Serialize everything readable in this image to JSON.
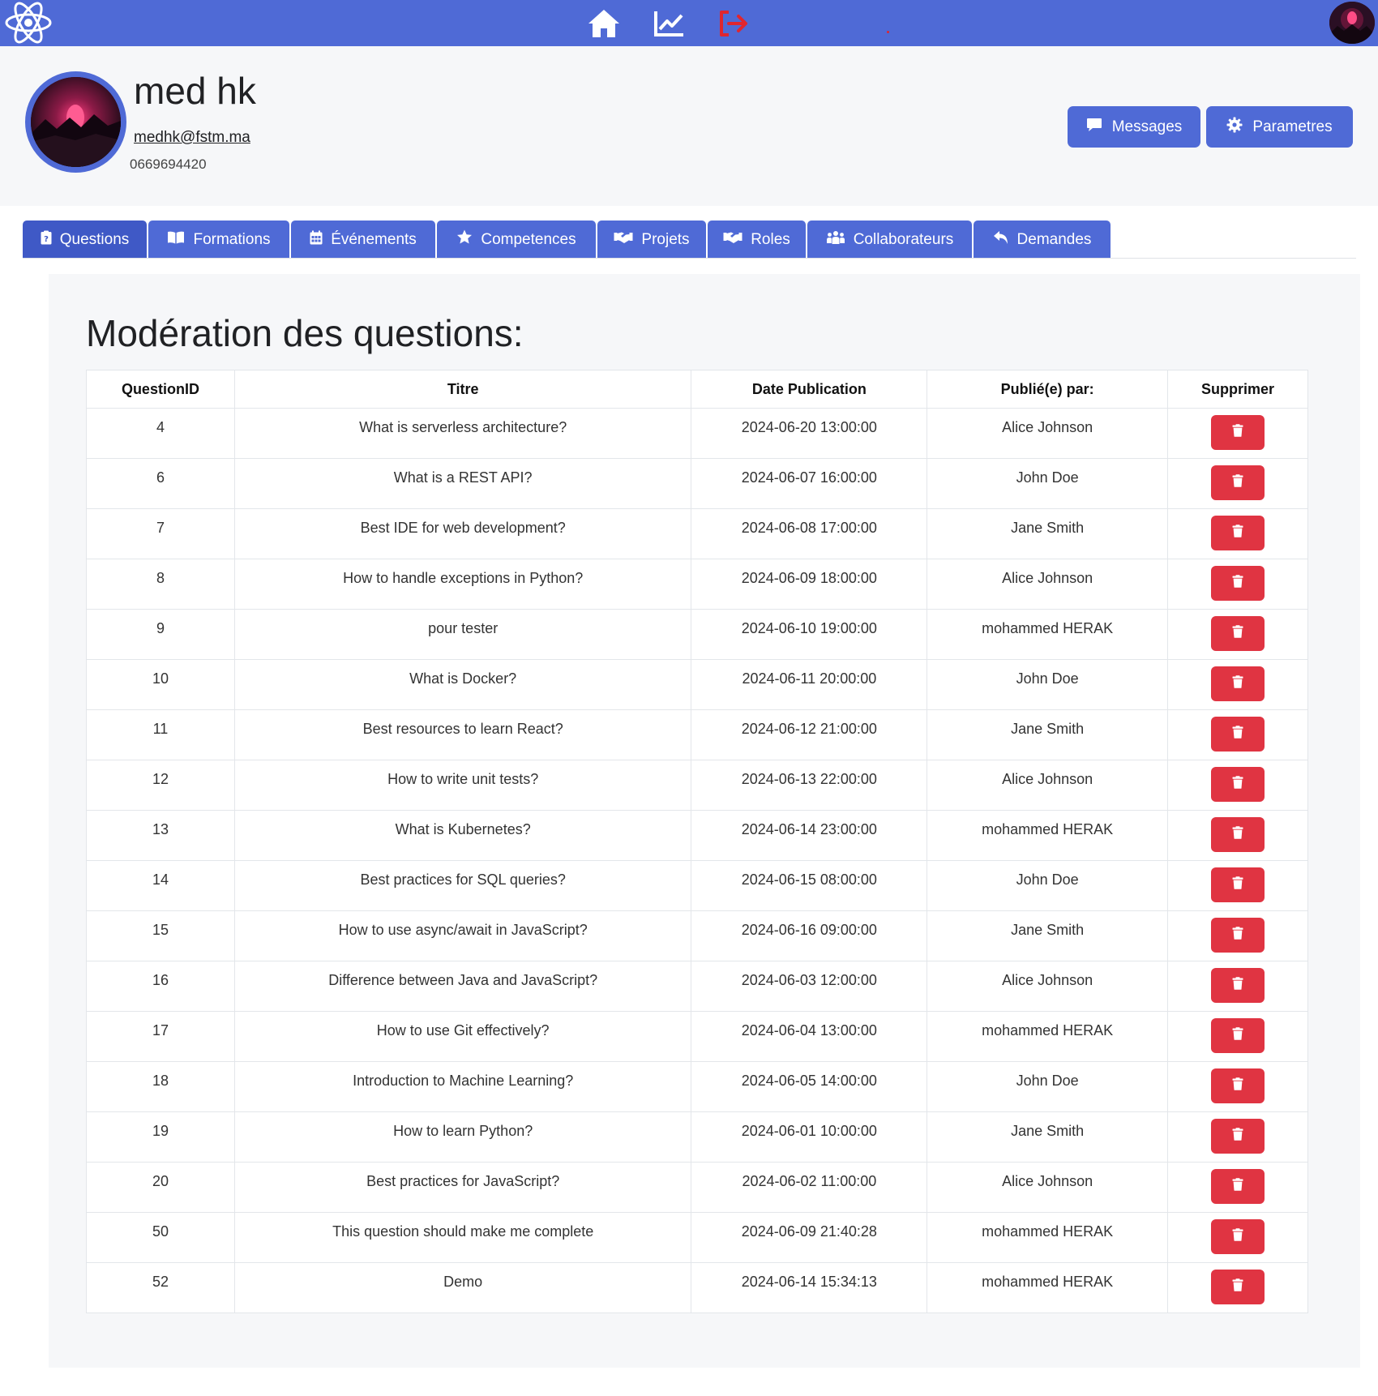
{
  "topbar": {
    "logo_icon": "atom-icon",
    "nav_icons": [
      "home-icon",
      "chart-line-icon",
      "logout-icon"
    ],
    "brand_color": "#4f6ad6"
  },
  "profile": {
    "name": "med hk",
    "email": "medhk@fstm.ma",
    "phone": "0669694420",
    "buttons": {
      "messages": "Messages",
      "params": "Parametres"
    }
  },
  "tabs": [
    {
      "label": "Questions",
      "icon": "question-clipboard-icon",
      "active": true
    },
    {
      "label": "Formations",
      "icon": "book-open-icon",
      "active": false
    },
    {
      "label": "Événements",
      "icon": "calendar-icon",
      "active": false
    },
    {
      "label": "Competences",
      "icon": "star-icon",
      "active": false
    },
    {
      "label": "Projets",
      "icon": "handshake-icon",
      "active": false
    },
    {
      "label": "Roles",
      "icon": "handshake-icon",
      "active": false
    },
    {
      "label": "Collaborateurs",
      "icon": "users-icon",
      "active": false
    },
    {
      "label": "Demandes",
      "icon": "reply-icon",
      "active": false
    }
  ],
  "moderation": {
    "title": "Modération des questions:",
    "columns": [
      "QuestionID",
      "Titre",
      "Date Publication",
      "Publié(e) par:",
      "Supprimer"
    ],
    "rows": [
      [
        "4",
        "What is serverless architecture?",
        "2024-06-20 13:00:00",
        "Alice Johnson"
      ],
      [
        "6",
        "What is a REST API?",
        "2024-06-07 16:00:00",
        "John Doe"
      ],
      [
        "7",
        "Best IDE for web development?",
        "2024-06-08 17:00:00",
        "Jane Smith"
      ],
      [
        "8",
        "How to handle exceptions in Python?",
        "2024-06-09 18:00:00",
        "Alice Johnson"
      ],
      [
        "9",
        "pour tester",
        "2024-06-10 19:00:00",
        "mohammed HERAK"
      ],
      [
        "10",
        "What is Docker?",
        "2024-06-11 20:00:00",
        "John Doe"
      ],
      [
        "11",
        "Best resources to learn React?",
        "2024-06-12 21:00:00",
        "Jane Smith"
      ],
      [
        "12",
        "How to write unit tests?",
        "2024-06-13 22:00:00",
        "Alice Johnson"
      ],
      [
        "13",
        "What is Kubernetes?",
        "2024-06-14 23:00:00",
        "mohammed HERAK"
      ],
      [
        "14",
        "Best practices for SQL queries?",
        "2024-06-15 08:00:00",
        "John Doe"
      ],
      [
        "15",
        "How to use async/await in JavaScript?",
        "2024-06-16 09:00:00",
        "Jane Smith"
      ],
      [
        "16",
        "Difference between Java and JavaScript?",
        "2024-06-03 12:00:00",
        "Alice Johnson"
      ],
      [
        "17",
        "How to use Git effectively?",
        "2024-06-04 13:00:00",
        "mohammed HERAK"
      ],
      [
        "18",
        "Introduction to Machine Learning?",
        "2024-06-05 14:00:00",
        "John Doe"
      ],
      [
        "19",
        "How to learn Python?",
        "2024-06-01 10:00:00",
        "Jane Smith"
      ],
      [
        "20",
        "Best practices for JavaScript?",
        "2024-06-02 11:00:00",
        "Alice Johnson"
      ],
      [
        "50",
        "This question should make me complete",
        "2024-06-09 21:40:28",
        "mohammed HERAK"
      ],
      [
        "52",
        "Demo",
        "2024-06-14 15:34:13",
        "mohammed HERAK"
      ]
    ],
    "delete_icon": "trash-icon",
    "delete_color": "#e03442"
  }
}
